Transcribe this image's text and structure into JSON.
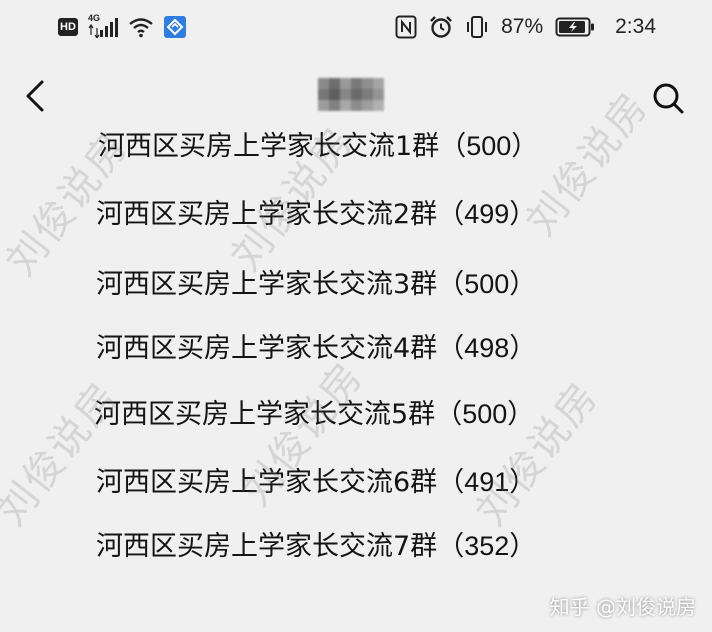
{
  "status_bar": {
    "hd": "HD",
    "network": "4G",
    "battery_percent": "87%",
    "time": "2:34",
    "icons": [
      "hd-icon",
      "signal-icon",
      "wifi-icon",
      "app-notification-icon",
      "nfc-icon",
      "alarm-icon",
      "vibrate-icon",
      "battery-icon"
    ]
  },
  "header": {
    "back_icon": "chevron-left-icon",
    "search_icon": "search-icon"
  },
  "groups": [
    {
      "name": "河西区买房上学家长交流1群",
      "open": "（",
      "count": "500",
      "close": "）"
    },
    {
      "name": "河西区买房上学家长交流2群",
      "open": "（",
      "count": "499",
      "close": "）"
    },
    {
      "name": "河西区买房上学家长交流3群",
      "open": "（",
      "count": "500",
      "close": "）"
    },
    {
      "name": "河西区买房上学家长交流4群",
      "open": "（",
      "count": "498",
      "close": "）"
    },
    {
      "name": "河西区买房上学家长交流5群",
      "open": "（",
      "count": "500",
      "close": "）"
    },
    {
      "name": "河西区买房上学家长交流6群",
      "open": "（",
      "count": "491",
      "close": "）"
    },
    {
      "name": "河西区买房上学家长交流7群",
      "open": "（",
      "count": "352",
      "close": "）"
    }
  ],
  "watermark": "刘俊说房",
  "credit": "知乎 @刘俊说房",
  "colors": {
    "background": "#f0f0f0",
    "text": "#141414",
    "watermark": "#787878",
    "app_icon_blue": "#2f7de1"
  }
}
